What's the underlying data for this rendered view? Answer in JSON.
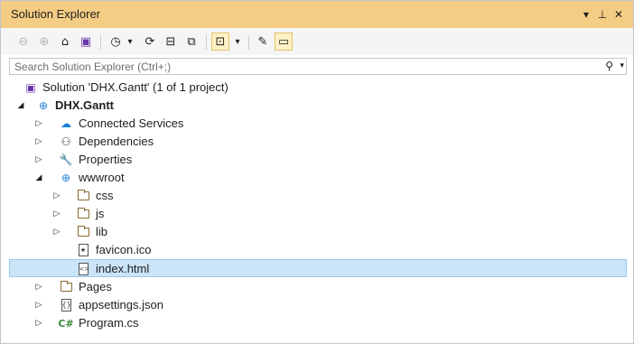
{
  "window": {
    "title": "Solution Explorer",
    "buttons": [
      "▾",
      "⊥",
      "✕"
    ]
  },
  "toolbar": {
    "back_icon": "⊖",
    "forward_icon": "⊕",
    "home_icon": "⌂",
    "switch_views_icon": "▣",
    "pending_changes_icon": "◷",
    "dropdown_icon": "▾",
    "sync_icon": "⟳",
    "collapse_icon": "⊟",
    "show_all_icon": "⧉",
    "sync_active_icon": "⊡",
    "dropdown2_icon": "▾",
    "properties_icon": "✎",
    "preview_icon": "▭"
  },
  "search": {
    "placeholder": "Search Solution Explorer (Ctrl+;)",
    "icon": "⚲",
    "dropdown": "▾"
  },
  "tree": {
    "solution": {
      "label": "Solution 'DHX.Gantt' (1 of 1 project)",
      "icon": "▣"
    },
    "project": {
      "label": "DHX.Gantt",
      "arrow": "◢",
      "icon": "⊕"
    },
    "connected_services": {
      "label": "Connected Services",
      "arrow": "▷",
      "icon": "☁"
    },
    "dependencies": {
      "label": "Dependencies",
      "arrow": "▷",
      "icon": "⚇"
    },
    "properties": {
      "label": "Properties",
      "arrow": "▷",
      "icon": "🔧"
    },
    "wwwroot": {
      "label": "wwwroot",
      "arrow": "◢",
      "icon": "⊕"
    },
    "css": {
      "label": "css",
      "arrow": "▷"
    },
    "js": {
      "label": "js",
      "arrow": "▷"
    },
    "lib": {
      "label": "lib",
      "arrow": "▷"
    },
    "favicon": {
      "label": "favicon.ico",
      "icon": "★"
    },
    "index": {
      "label": "index.html",
      "icon": "<>"
    },
    "pages": {
      "label": "Pages",
      "arrow": "▷"
    },
    "appsettings": {
      "label": "appsettings.json",
      "arrow": "▷",
      "icon": "{}"
    },
    "program": {
      "label": "Program.cs",
      "arrow": "▷",
      "icon": "C#"
    }
  },
  "colors": {
    "titlebar": "#f5cc84",
    "selection": "#cce4f7",
    "selection_border": "#99c9ef",
    "csharp": "#388a34",
    "web": "#1a7dd6"
  }
}
